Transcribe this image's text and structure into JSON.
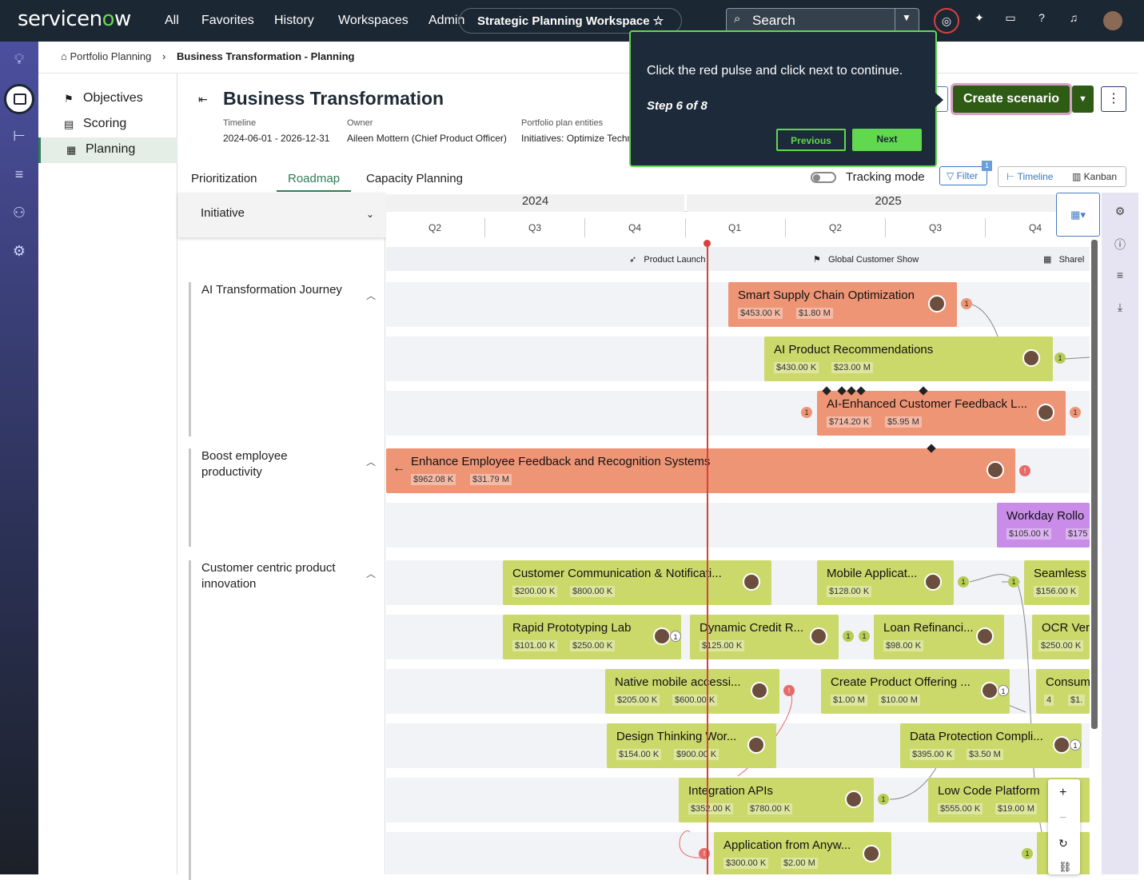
{
  "topbar": {
    "logo_a": "servicen",
    "logo_b": "o",
    "logo_c": "w",
    "nav": [
      "All",
      "Favorites",
      "History",
      "Workspaces",
      "Admin"
    ],
    "workspace": "Strategic Planning Workspace",
    "search_placeholder": "Search"
  },
  "breadcrumb": {
    "root": "Portfolio Planning",
    "current": "Business Transformation - Planning"
  },
  "leftnav": [
    {
      "label": "Objectives",
      "icon": "flag-icon"
    },
    {
      "label": "Scoring",
      "icon": "score-icon"
    },
    {
      "label": "Planning",
      "icon": "table-icon"
    }
  ],
  "page": {
    "title": "Business Transformation",
    "timeline_label": "Timeline",
    "timeline": "2024-06-01 - 2026-12-31",
    "owner_label": "Owner",
    "owner": "Aileen Mottern (Chief Product Officer)",
    "entities_label": "Portfolio plan entities",
    "entities": "Initiatives: Optimize Techn"
  },
  "tabs": [
    "Prioritization",
    "Roadmap",
    "Capacity Planning"
  ],
  "toolbar": {
    "tracking": "Tracking mode",
    "filter": "Filter",
    "filter_badge": "1",
    "timeline": "Timeline",
    "kanban": "Kanban",
    "create": "Create scenario"
  },
  "tour": {
    "message": "Click the red pulse and click next to continue.",
    "step": "Step 6 of 8",
    "previous": "Previous",
    "next": "Next"
  },
  "initiative_header": "Initiative",
  "groups": [
    "AI Transformation Journey",
    "Boost employee productivity",
    "Customer centric product innovation"
  ],
  "years": [
    "2024",
    "2025"
  ],
  "quarters": [
    "Q2",
    "Q3",
    "Q4",
    "Q1",
    "Q2",
    "Q3",
    "Q4"
  ],
  "milestones": [
    "Product Launch",
    "Global Customer Show",
    "Sharel"
  ],
  "bars": [
    {
      "name": "Smart Supply Chain Optimization",
      "c1": "$453.00 K",
      "c2": "$1.80 M"
    },
    {
      "name": "AI Product Recommendations",
      "c1": "$430.00 K",
      "c2": "$23.00 M"
    },
    {
      "name": "AI-Enhanced Customer Feedback L...",
      "c1": "$714.20 K",
      "c2": "$5.95 M"
    },
    {
      "name": "Enhance Employee Feedback and Recognition Systems",
      "c1": "$962.08 K",
      "c2": "$31.79 M"
    },
    {
      "name": "Workday Rollo",
      "c1": "$105.00 K",
      "c2": "$175"
    },
    {
      "name": "Customer Communication & Notificati...",
      "c1": "$200.00 K",
      "c2": "$800.00 K"
    },
    {
      "name": "Mobile Applicat...",
      "c1": "$128.00 K",
      "c2": ""
    },
    {
      "name": "Seamless",
      "c1": "$156.00 K",
      "c2": ""
    },
    {
      "name": "Rapid Prototyping Lab",
      "c1": "$101.00 K",
      "c2": "$250.00 K"
    },
    {
      "name": "Dynamic Credit R...",
      "c1": "$125.00 K",
      "c2": ""
    },
    {
      "name": "Loan Refinanci...",
      "c1": "$98.00 K",
      "c2": ""
    },
    {
      "name": "OCR Ver",
      "c1": "$250.00 K",
      "c2": ""
    },
    {
      "name": "Native mobile accessi...",
      "c1": "$205.00 K",
      "c2": "$600.00 K"
    },
    {
      "name": "Create Product Offering ...",
      "c1": "$1.00 M",
      "c2": "$10.00 M"
    },
    {
      "name": "Consum",
      "c1": "4",
      "c2": "$1."
    },
    {
      "name": "Design Thinking Wor...",
      "c1": "$154.00 K",
      "c2": "$900.00 K"
    },
    {
      "name": "Data Protection Compli...",
      "c1": "$395.00 K",
      "c2": "$3.50 M"
    },
    {
      "name": "Integration APIs",
      "c1": "$352.00 K",
      "c2": "$780.00 K"
    },
    {
      "name": "Low Code Platform",
      "c1": "$555.00 K",
      "c2": "$19.00 M"
    },
    {
      "name": "Application from Anyw...",
      "c1": "$300.00 K",
      "c2": "$2.00 M"
    },
    {
      "name": "",
      "c1": "",
      "c2": ""
    }
  ],
  "dep_counts": [
    "1",
    "1",
    "1",
    "1",
    "1",
    "1",
    "1",
    "1",
    "1",
    "1",
    "1",
    "1",
    "1",
    "!",
    "!",
    "!"
  ],
  "zoom": {
    "plus": "+",
    "minus": "−"
  }
}
